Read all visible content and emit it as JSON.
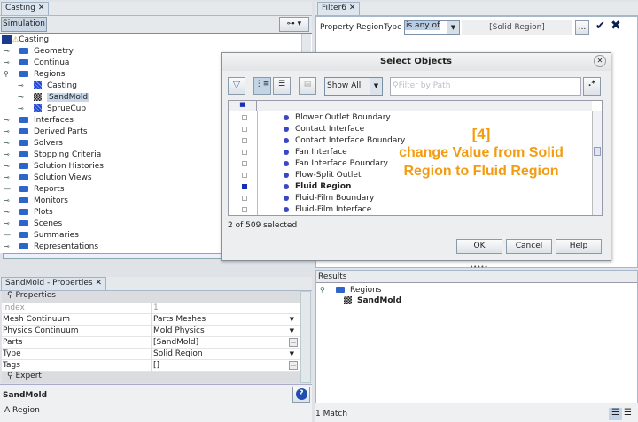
{
  "left_top": {
    "tab": "Casting",
    "toolbar_button": "Simulation",
    "tree": [
      {
        "label": "Casting",
        "level": 0
      },
      {
        "label": "Geometry",
        "level": 1
      },
      {
        "label": "Continua",
        "level": 1
      },
      {
        "label": "Regions",
        "level": 1
      },
      {
        "label": "Casting",
        "level": 2
      },
      {
        "label": "SandMold",
        "level": 2
      },
      {
        "label": "SprueCup",
        "level": 2
      },
      {
        "label": "Interfaces",
        "level": 1
      },
      {
        "label": "Derived Parts",
        "level": 1
      },
      {
        "label": "Solvers",
        "level": 1
      },
      {
        "label": "Stopping Criteria",
        "level": 1
      },
      {
        "label": "Solution Histories",
        "level": 1
      },
      {
        "label": "Solution Views",
        "level": 1
      },
      {
        "label": "Reports",
        "level": 1
      },
      {
        "label": "Monitors",
        "level": 1
      },
      {
        "label": "Plots",
        "level": 1
      },
      {
        "label": "Scenes",
        "level": 1
      },
      {
        "label": "Summaries",
        "level": 1
      },
      {
        "label": "Representations",
        "level": 1
      }
    ]
  },
  "properties": {
    "tab": "SandMold - Properties",
    "section": "Properties",
    "expert": "Expert",
    "rows": [
      {
        "name": "Index",
        "value": "1"
      },
      {
        "name": "Mesh Continuum",
        "value": "Parts Meshes"
      },
      {
        "name": "Physics Continuum",
        "value": "Mold Physics"
      },
      {
        "name": "Parts",
        "value": "[SandMold]"
      },
      {
        "name": "Type",
        "value": "Solid Region"
      },
      {
        "name": "Tags",
        "value": "[]"
      }
    ],
    "desc_title": "SandMold",
    "desc_text": "A Region"
  },
  "filter": {
    "tab": "Filter6",
    "property": "Property",
    "region": "Region",
    "type": "Type",
    "operator": "is any of",
    "value": "[Solid Region]",
    "ellipsis": "..."
  },
  "dialog": {
    "title": "Select Objects",
    "show": "Show All",
    "filter_placeholder": "Filter by Path",
    "regex": ".*",
    "items": [
      {
        "label": "Blower Outlet Boundary",
        "checked": false
      },
      {
        "label": "Contact Interface",
        "checked": false
      },
      {
        "label": "Contact Interface Boundary",
        "checked": false
      },
      {
        "label": "Fan Interface",
        "checked": false
      },
      {
        "label": "Fan Interface Boundary",
        "checked": false
      },
      {
        "label": "Flow-Split Outlet",
        "checked": false
      },
      {
        "label": "Fluid Region",
        "checked": true
      },
      {
        "label": "Fluid-Film Boundary",
        "checked": false
      },
      {
        "label": "Fluid-Film Interface",
        "checked": false
      }
    ],
    "status": "2 of 509 selected",
    "ok": "OK",
    "cancel": "Cancel",
    "help": "Help"
  },
  "annotation": {
    "step": "[4]",
    "line1": "change Value from Solid",
    "line2": "Region to Fluid Region",
    "color": "#f39c12"
  },
  "results": {
    "header": "Results",
    "folder": "Regions",
    "item": "SandMold",
    "status": "1 Match"
  }
}
